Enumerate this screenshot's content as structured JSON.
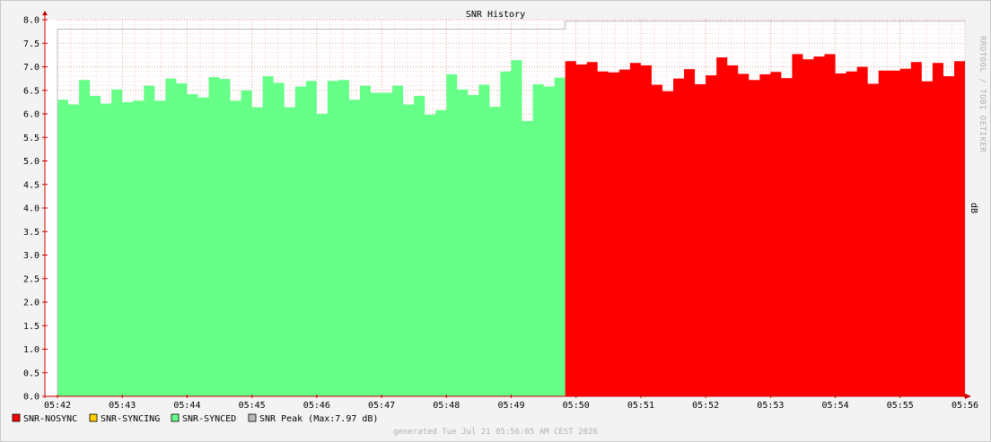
{
  "chart_data": {
    "type": "area",
    "title": "SNR History",
    "ylabel": "dB",
    "ylim": [
      0,
      8
    ],
    "yticks": [
      "0.0",
      "0.5",
      "1.0",
      "1.5",
      "2.0",
      "2.5",
      "3.0",
      "3.5",
      "4.0",
      "4.5",
      "5.0",
      "5.5",
      "6.0",
      "6.5",
      "7.0",
      "7.5",
      "8.0"
    ],
    "xticks": [
      "05:42",
      "05:43",
      "05:44",
      "05:45",
      "05:46",
      "05:47",
      "05:48",
      "05:49",
      "05:50",
      "05:51",
      "05:52",
      "05:53",
      "05:54",
      "05:55",
      "05:56"
    ],
    "xlim_minutes": [
      42,
      56
    ],
    "grid": true,
    "colors": {
      "nosync": "#ff0000",
      "syncing": "#ffcc00",
      "synced": "#66ff88",
      "peak": "#bbbbbb",
      "grid_major": "#e08080",
      "grid_minor": "#ffb0b0",
      "axis": "#cc0000"
    },
    "series": [
      {
        "name": "SNR-SYNCED",
        "x_start": 42.0,
        "x_end": 49.833,
        "values": [
          6.3,
          6.2,
          6.72,
          6.38,
          6.22,
          6.52,
          6.25,
          6.28,
          6.6,
          6.28,
          6.75,
          6.65,
          6.42,
          6.35,
          6.78,
          6.74,
          6.28,
          6.5,
          6.14,
          6.8,
          6.66,
          6.14,
          6.58,
          6.7,
          6.0,
          6.7,
          6.72,
          6.3,
          6.6,
          6.45,
          6.45,
          6.6,
          6.2,
          6.38,
          5.98,
          6.08,
          6.84,
          6.52,
          6.4,
          6.62,
          6.15,
          6.9,
          7.14,
          5.85,
          6.63,
          6.58,
          6.77
        ]
      },
      {
        "name": "SNR-NOSYNC",
        "x_start": 49.833,
        "x_end": 56.0,
        "values": [
          7.12,
          7.05,
          7.1,
          6.9,
          6.88,
          6.94,
          7.08,
          7.03,
          6.62,
          6.48,
          6.75,
          6.95,
          6.63,
          6.82,
          7.2,
          7.03,
          6.85,
          6.72,
          6.84,
          6.89,
          6.76,
          7.27,
          7.16,
          7.22,
          7.27,
          6.86,
          6.9,
          7.0,
          6.64,
          6.92,
          6.92,
          6.96,
          7.1,
          6.69,
          7.08,
          6.8,
          7.12
        ]
      }
    ],
    "peak": {
      "name": "SNR Peak",
      "segments": [
        {
          "x_start": 42.0,
          "x_end": 49.833,
          "value": 7.8
        },
        {
          "x_start": 49.833,
          "x_end": 56.0,
          "value": 7.97
        }
      ]
    },
    "legend": [
      {
        "key": "nosync",
        "label": "SNR-NOSYNC"
      },
      {
        "key": "syncing",
        "label": "SNR-SYNCING"
      },
      {
        "key": "synced",
        "label": "SNR-SYNCED"
      },
      {
        "key": "peak",
        "label": "SNR Peak  (Max:7.97 dB)"
      }
    ],
    "credit": "RRDTOOL / TOBI OETIKER",
    "footer": "generated Tue Jul 21 05:56:05 AM CEST 2026"
  }
}
